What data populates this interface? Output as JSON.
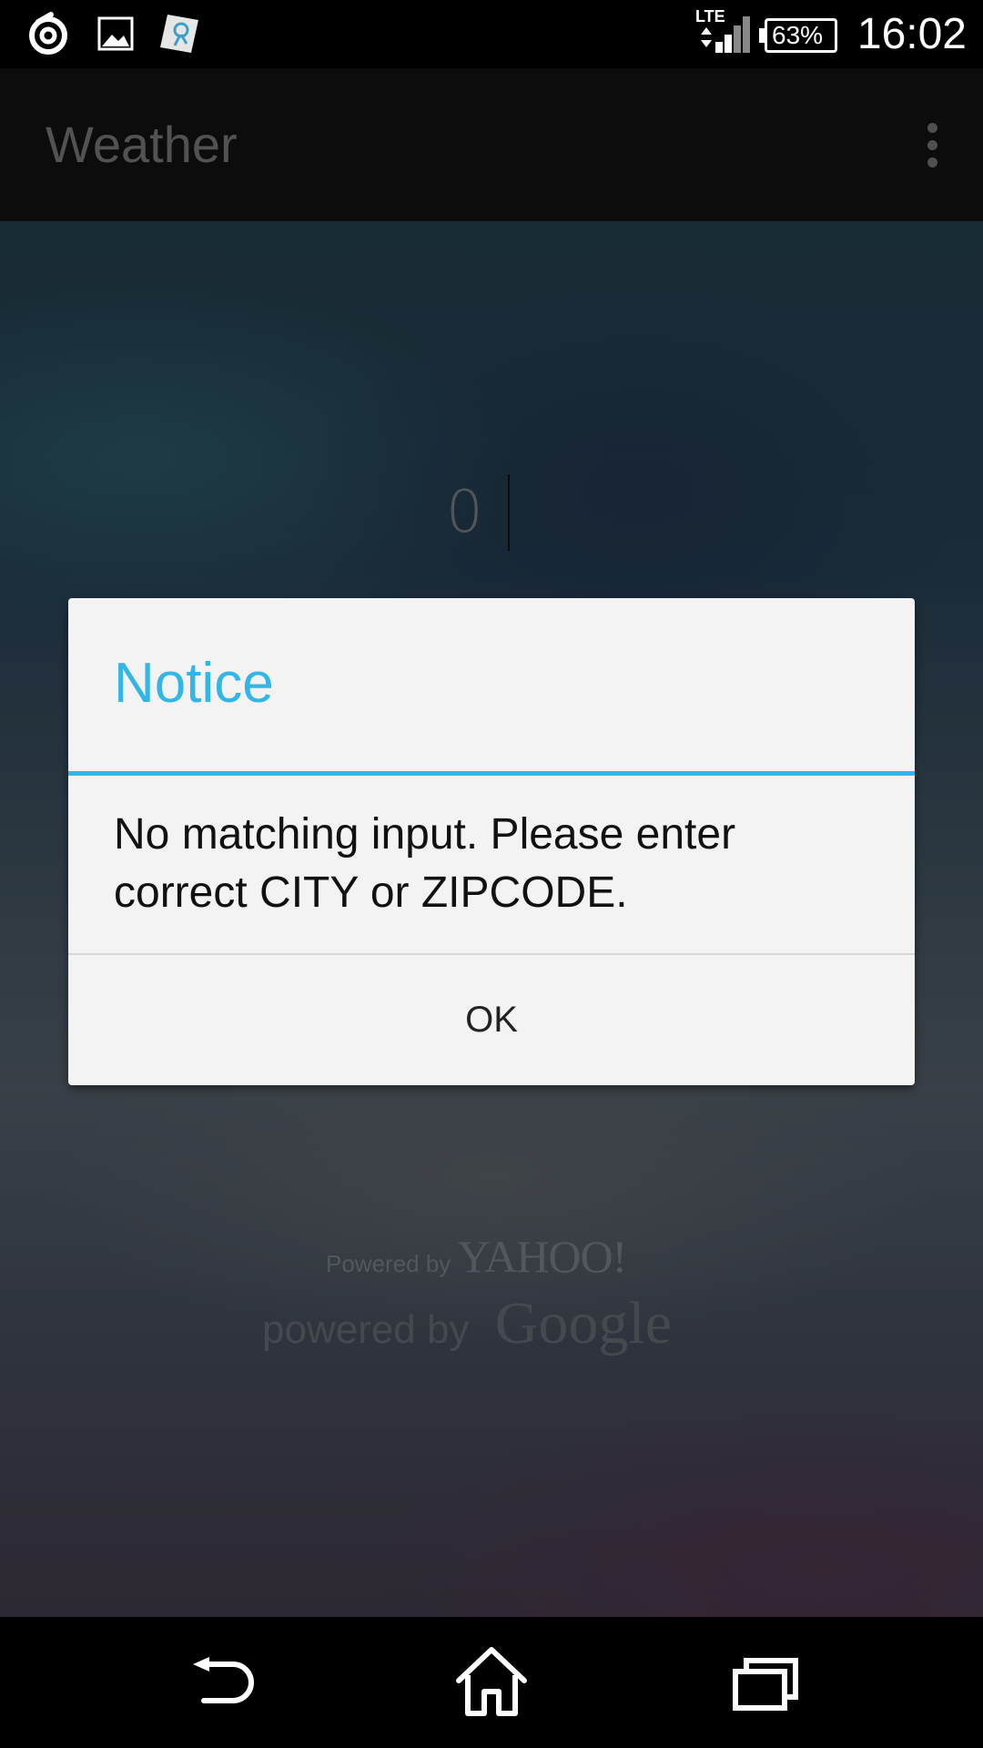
{
  "status_bar": {
    "icons_left": [
      "swirl-notification-icon",
      "image-notification-icon",
      "beam-notification-icon"
    ],
    "network": "LTE",
    "battery": "63%",
    "time": "16:02"
  },
  "app_bar": {
    "title": "Weather",
    "menu_icon": "overflow-menu-icon"
  },
  "city_input": {
    "value": "0"
  },
  "attribution": {
    "yahoo_prefix": "Powered by",
    "yahoo_brand": "YAHOO!",
    "google_prefix": "powered by",
    "google_brand": "Google"
  },
  "dialog": {
    "title": "Notice",
    "message": "No matching input. Please enter correct CITY or ZIPCODE.",
    "ok_label": "OK",
    "accent_color": "#33b5e5"
  },
  "nav_bar": {
    "buttons": [
      "back-icon",
      "home-icon",
      "recent-apps-icon"
    ]
  }
}
